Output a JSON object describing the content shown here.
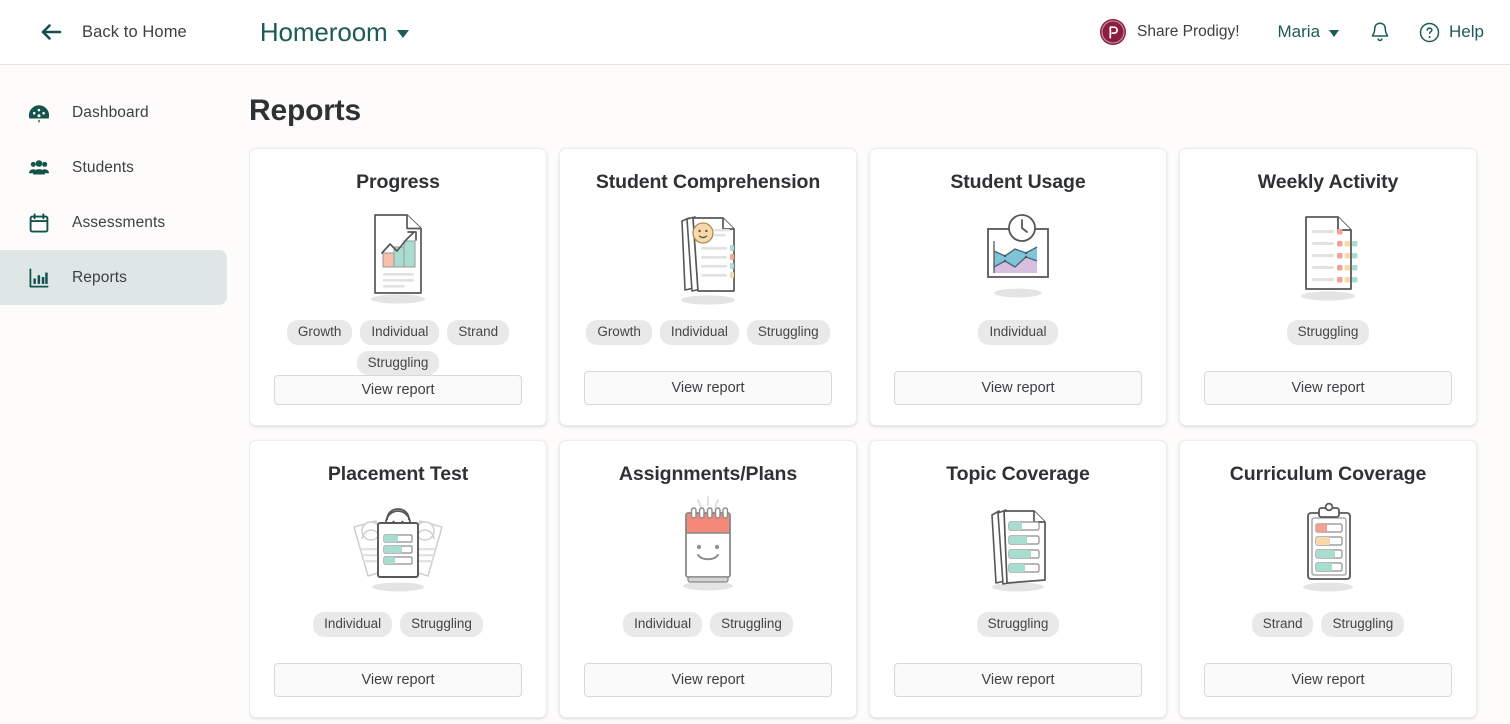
{
  "header": {
    "back_label": "Back to Home",
    "back_icon": "arrow-left-icon",
    "homeroom_title": "Homeroom",
    "homeroom_caret_icon": "chevron-down-icon",
    "share_label": "Share Prodigy!",
    "share_logo_icon": "prodigy-logo-icon",
    "user_name": "Maria",
    "user_caret_icon": "chevron-down-icon",
    "notifications_icon": "bell-icon",
    "help_label": "Help",
    "help_icon": "question-circle-icon"
  },
  "colors": {
    "brand_teal": "#1d5b54",
    "prodigy_maroon": "#8b1d3f",
    "page_background": "#fdfcfa",
    "card_background": "#ffffff",
    "active_nav_background": "#dee7e5",
    "tag_background": "#e9e9e9",
    "accent_coral": "#f28b7d",
    "accent_mint": "#a8ddd0",
    "accent_peach": "#f7d9ad",
    "accent_blue": "#7fc4d8",
    "accent_lavender": "#d8bfe0"
  },
  "sidebar": {
    "items": [
      {
        "label": "Dashboard",
        "icon": "dashboard-gauge-icon",
        "active": false
      },
      {
        "label": "Students",
        "icon": "students-group-icon",
        "active": false
      },
      {
        "label": "Assessments",
        "icon": "calendar-icon",
        "active": false
      },
      {
        "label": "Reports",
        "icon": "bar-chart-icon",
        "active": true
      }
    ]
  },
  "main": {
    "page_title": "Reports",
    "view_report_label": "View report",
    "cards": [
      {
        "title": "Progress",
        "illustration": "document-growth-chart-illustration",
        "tags": [
          "Growth",
          "Individual",
          "Strand",
          "Struggling"
        ]
      },
      {
        "title": "Student Comprehension",
        "illustration": "stacked-papers-smiley-illustration",
        "tags": [
          "Growth",
          "Individual",
          "Struggling"
        ]
      },
      {
        "title": "Student Usage",
        "illustration": "area-chart-clock-illustration",
        "tags": [
          "Individual"
        ]
      },
      {
        "title": "Weekly Activity",
        "illustration": "document-colored-dots-illustration",
        "tags": [
          "Struggling"
        ]
      },
      {
        "title": "Placement Test",
        "illustration": "students-report-card-illustration",
        "tags": [
          "Individual",
          "Struggling"
        ]
      },
      {
        "title": "Assignments/Plans",
        "illustration": "smiling-calendar-illustration",
        "tags": [
          "Individual",
          "Struggling"
        ]
      },
      {
        "title": "Topic Coverage",
        "illustration": "stacked-papers-progress-bars-illustration",
        "tags": [
          "Struggling"
        ]
      },
      {
        "title": "Curriculum Coverage",
        "illustration": "clipboard-progress-bars-illustration",
        "tags": [
          "Strand",
          "Struggling"
        ]
      }
    ]
  }
}
